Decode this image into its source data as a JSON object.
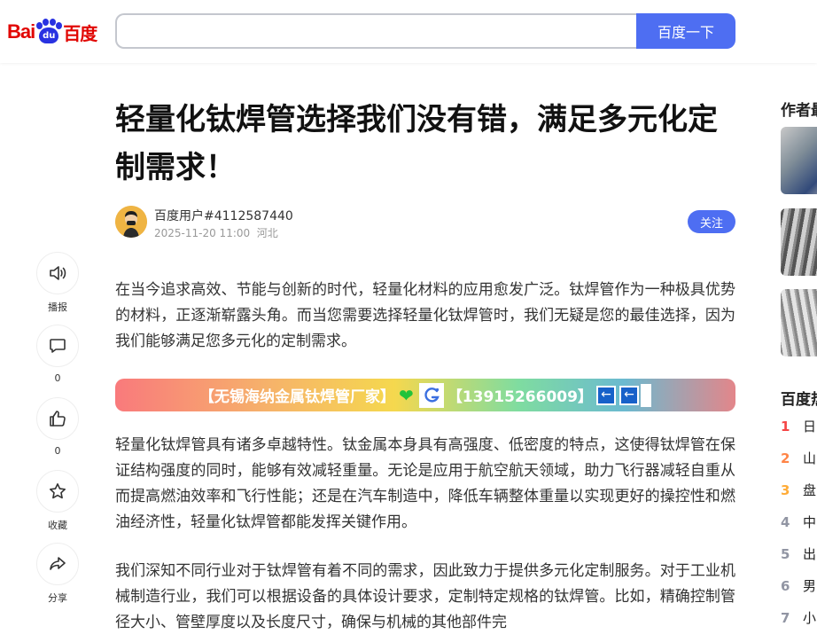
{
  "header": {
    "logo": {
      "bai": "Bai",
      "paw": "du",
      "cn": "百度"
    },
    "search": {
      "value": "",
      "placeholder": ""
    },
    "search_button": "百度一下"
  },
  "rail": [
    {
      "name": "broadcast",
      "icon": "speaker-icon",
      "label": "播报"
    },
    {
      "name": "comment",
      "icon": "comment-icon",
      "label": "0"
    },
    {
      "name": "like",
      "icon": "thumbs-up-icon",
      "label": "0"
    },
    {
      "name": "favorite",
      "icon": "star-icon",
      "label": "收藏"
    },
    {
      "name": "share",
      "icon": "share-icon",
      "label": "分享"
    }
  ],
  "article": {
    "title": "轻量化钛焊管选择我们没有错，满足多元化定制需求！",
    "author": {
      "name": "百度用户#4112587440",
      "datetime": "2025-11-20 11:00",
      "location": "河北",
      "follow_label": "关注"
    },
    "paragraphs": [
      "在当今追求高效、节能与创新的时代，轻量化材料的应用愈发广泛。钛焊管作为一种极具优势的材料，正逐渐崭露头角。而当您需要选择轻量化钛焊管时，我们无疑是您的最佳选择，因为我们能够满足您多元化的定制需求。",
      "轻量化钛焊管具有诸多卓越特性。钛金属本身具有高强度、低密度的特点，这使得钛焊管在保证结构强度的同时，能够有效减轻重量。无论是应用于航空航天领域，助力飞行器减轻自重从而提高燃油效率和飞行性能；还是在汽车制造中，降低车辆整体重量以实现更好的操控性和燃油经济性，轻量化钛焊管都能发挥关键作用。",
      "我们深知不同行业对于钛焊管有着不同的需求，因此致力于提供多元化定制服务。对于工业机械制造行业，我们可以根据设备的具体设计要求，定制特定规格的钛焊管。比如，精确控制管径大小、管壁厚度以及长度尺寸，确保与机械的其他部件完"
    ],
    "banner": {
      "company": "【无锡海纳金属钛焊管厂家】",
      "phone": "【13915266009】",
      "arrow": "←"
    }
  },
  "sidebar": {
    "author_section_title": "作者最",
    "hot_section_title": "百度热",
    "hot_items": [
      {
        "rank": "1",
        "text": "日",
        "color": "#f54545"
      },
      {
        "rank": "2",
        "text": "山",
        "color": "#ff8547"
      },
      {
        "rank": "3",
        "text": "盘",
        "color": "#ffac38"
      },
      {
        "rank": "4",
        "text": "中",
        "color": "#9195a3"
      },
      {
        "rank": "5",
        "text": "出",
        "color": "#9195a3"
      },
      {
        "rank": "6",
        "text": "男",
        "color": "#9195a3"
      },
      {
        "rank": "7",
        "text": "小",
        "color": "#9195a3"
      }
    ]
  },
  "colors": {
    "brand_blue": "#4e6ef2",
    "brand_red": "#e10602"
  }
}
